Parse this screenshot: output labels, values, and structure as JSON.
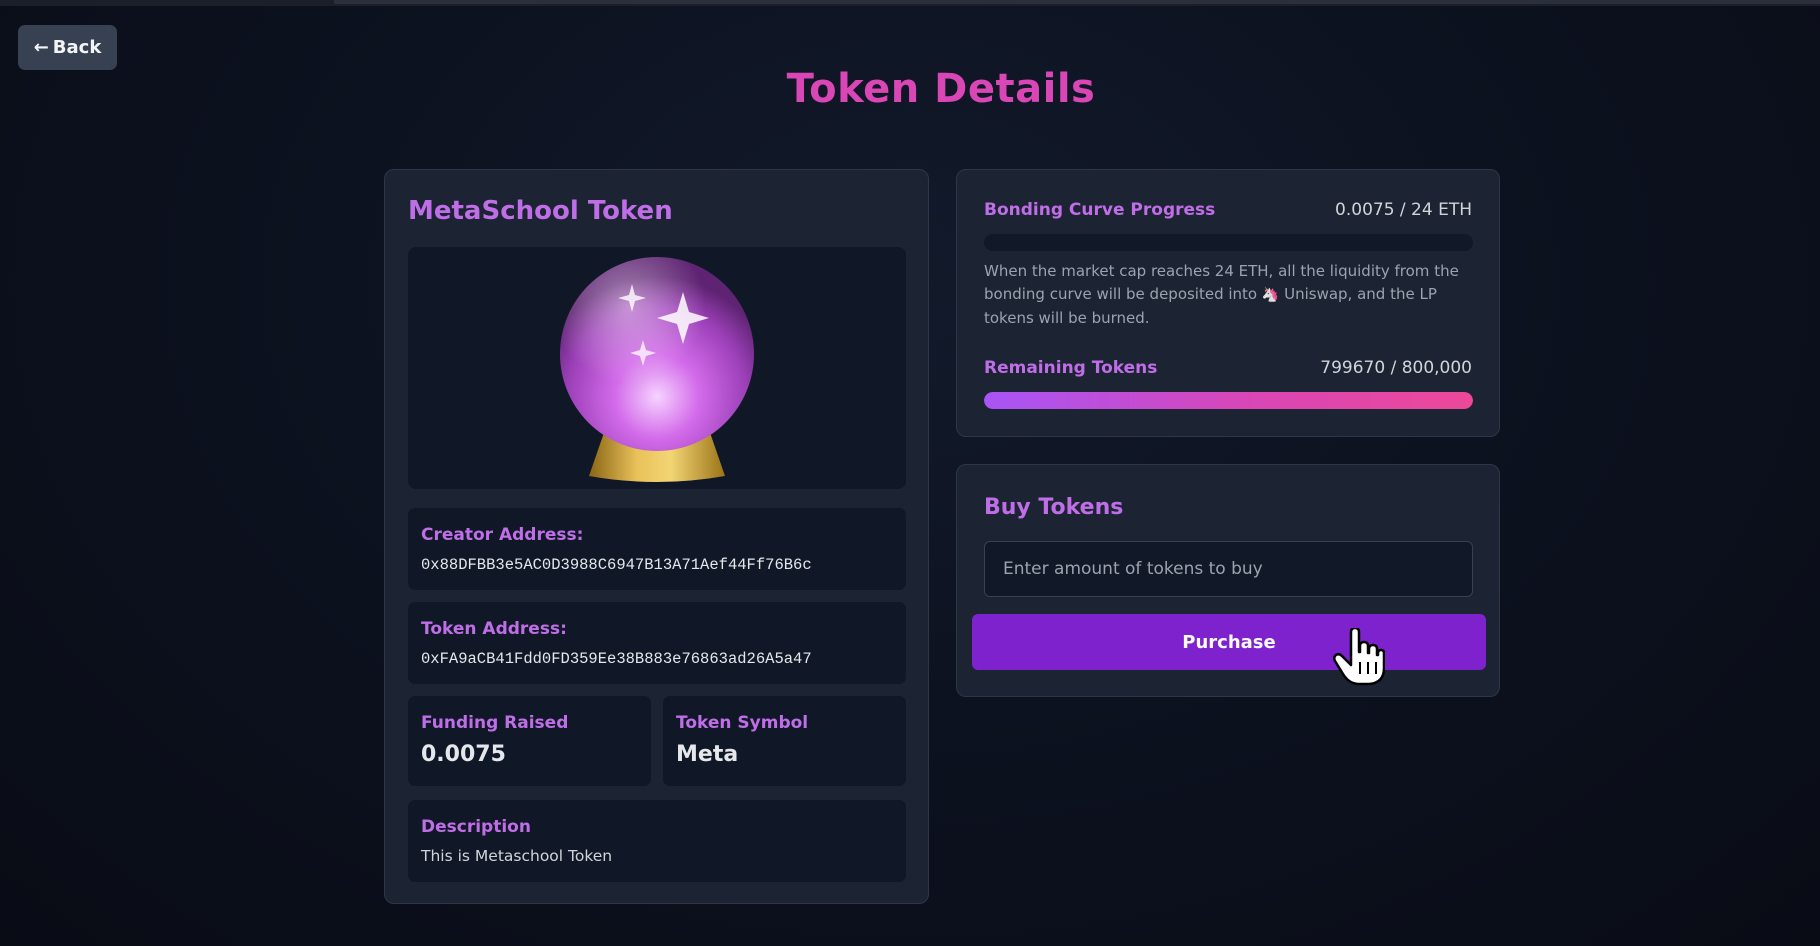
{
  "header": {
    "back_label": "Back",
    "title": "Token Details"
  },
  "token": {
    "name": "MetaSchool Token",
    "image_icon": "crystal-ball-icon",
    "creator_label": "Creator Address:",
    "creator_address": "0x88DFBB3e5AC0D3988C6947B13A71Aef44Ff76B6c",
    "token_address_label": "Token Address:",
    "token_address": "0xFA9aCB41Fdd0FD359Ee38B883e76863ad26A5a47",
    "funding_label": "Funding Raised",
    "funding_value": "0.0075",
    "symbol_label": "Token Symbol",
    "symbol_value": "Meta",
    "description_label": "Description",
    "description_text": "This is Metaschool Token"
  },
  "progress": {
    "bonding_label": "Bonding Curve Progress",
    "bonding_value": "0.0075 / 24 ETH",
    "bonding_fraction": 0.0003,
    "note_before": "When the market cap reaches 24 ETH, all the liquidity from the bonding curve will be deposited into",
    "note_icon": "unicorn-icon",
    "note_after": "Uniswap, and the LP tokens will be burned.",
    "remaining_label": "Remaining Tokens",
    "remaining_value": "799670 / 800,000",
    "remaining_fraction": 0.9996
  },
  "buy": {
    "title": "Buy Tokens",
    "input_placeholder": "Enter amount of tokens to buy",
    "input_value": "",
    "purchase_label": "Purchase"
  },
  "colors": {
    "accent_pink": "#d946b5",
    "accent_purple": "#c06ee8",
    "button_purple": "#7e22ce",
    "panel_bg": "#1c2433",
    "inner_bg": "#101827"
  }
}
